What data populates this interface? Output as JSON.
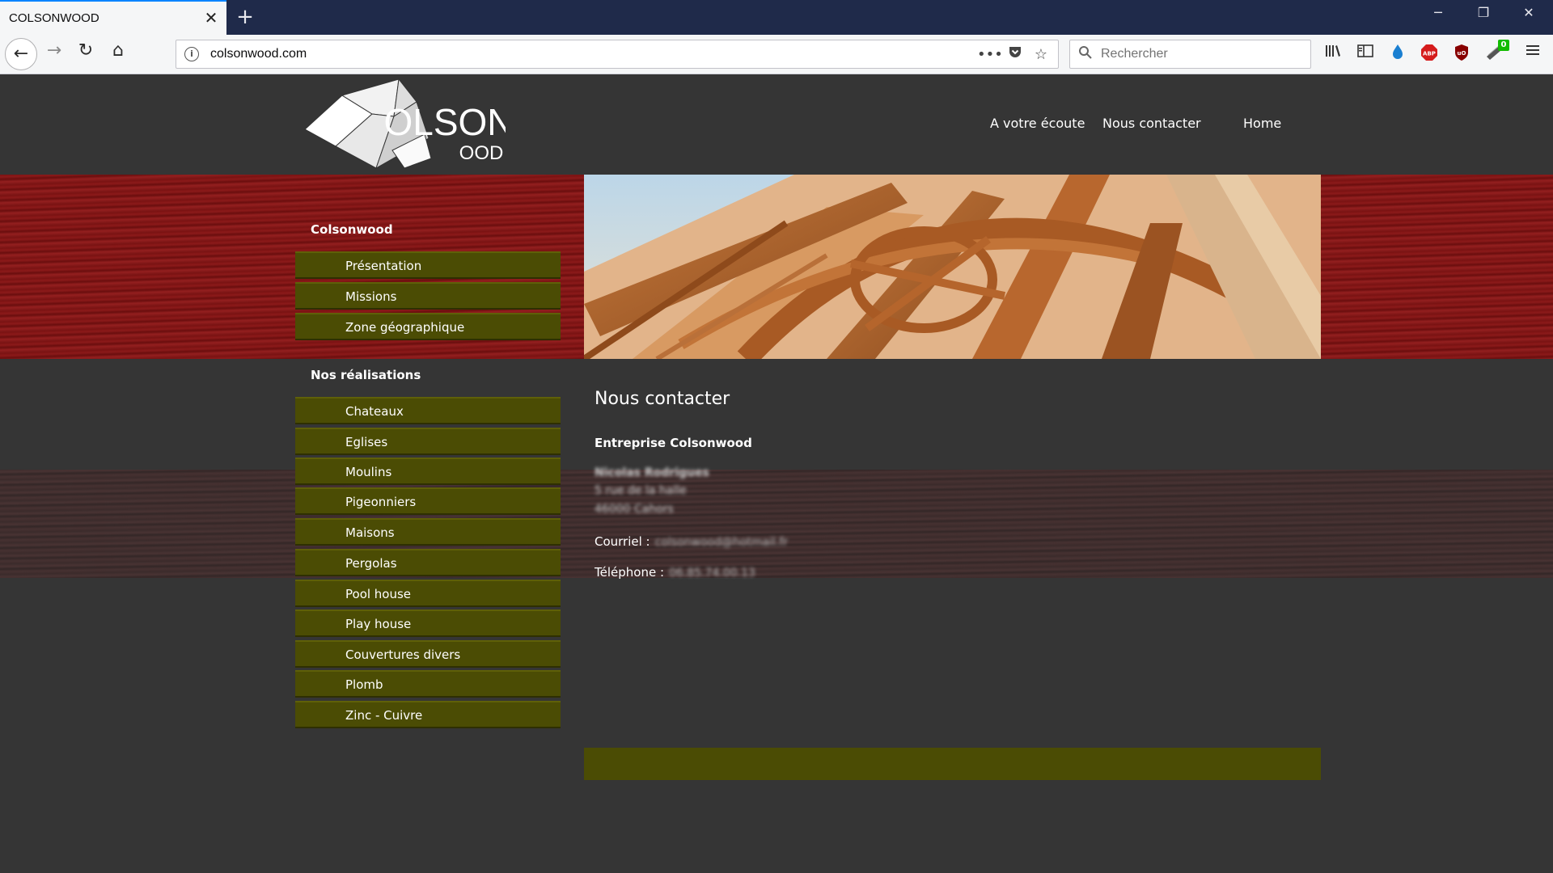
{
  "browser": {
    "tab_title": "COLSONWOOD",
    "tab_close": "✕",
    "new_tab": "+",
    "url": "colsonwood.com",
    "search_placeholder": "Rechercher",
    "extension_badge": "0",
    "icons": [
      "back-arrow-icon",
      "forward-arrow-icon",
      "reload-icon",
      "home-icon",
      "info-icon",
      "page-actions-icon",
      "pocket-icon",
      "bookmark-star-icon",
      "search-icon",
      "library-icon",
      "sidebar-icon",
      "raindrop-icon",
      "adblock-plus-icon",
      "ublock-origin-icon",
      "extension-icon",
      "hamburger-menu-icon"
    ],
    "window_controls": [
      "─",
      "❐",
      "✕"
    ]
  },
  "site": {
    "logo_text_main": "OLSON",
    "logo_text_sub": "OOD",
    "nav": [
      {
        "label": "A votre écoute"
      },
      {
        "label": "Nous contacter"
      },
      {
        "label": "Home"
      }
    ],
    "sidebar": {
      "section1_title": "Colsonwood",
      "section1_items": [
        {
          "label": "Présentation"
        },
        {
          "label": "Missions"
        },
        {
          "label": "Zone géographique"
        }
      ],
      "section2_title": "Nos réalisations",
      "section2_items": [
        {
          "label": "Chateaux"
        },
        {
          "label": "Eglises"
        },
        {
          "label": "Moulins"
        },
        {
          "label": "Pigeonniers"
        },
        {
          "label": "Maisons"
        },
        {
          "label": "Pergolas"
        },
        {
          "label": "Pool house"
        },
        {
          "label": "Play house"
        },
        {
          "label": "Couvertures divers"
        },
        {
          "label": "Plomb"
        },
        {
          "label": "Zinc - Cuivre"
        }
      ]
    },
    "content": {
      "title": "Nous contacter",
      "company": "Entreprise Colsonwood",
      "contact_name": "Nicolas Rodrigues",
      "address_line1": "5 rue de la halle",
      "address_line2": "46000 Cahors",
      "email_label": "Courriel :",
      "email_value": "colsonwood@hotmail.fr",
      "phone_label": "Téléphone :",
      "phone_value": "06.85.74.00.13"
    },
    "colors": {
      "background": "#353535",
      "menu_olive": "#4b4c04",
      "wood_red": "#7a1212",
      "browser_dark": "#1f2a4a"
    }
  }
}
